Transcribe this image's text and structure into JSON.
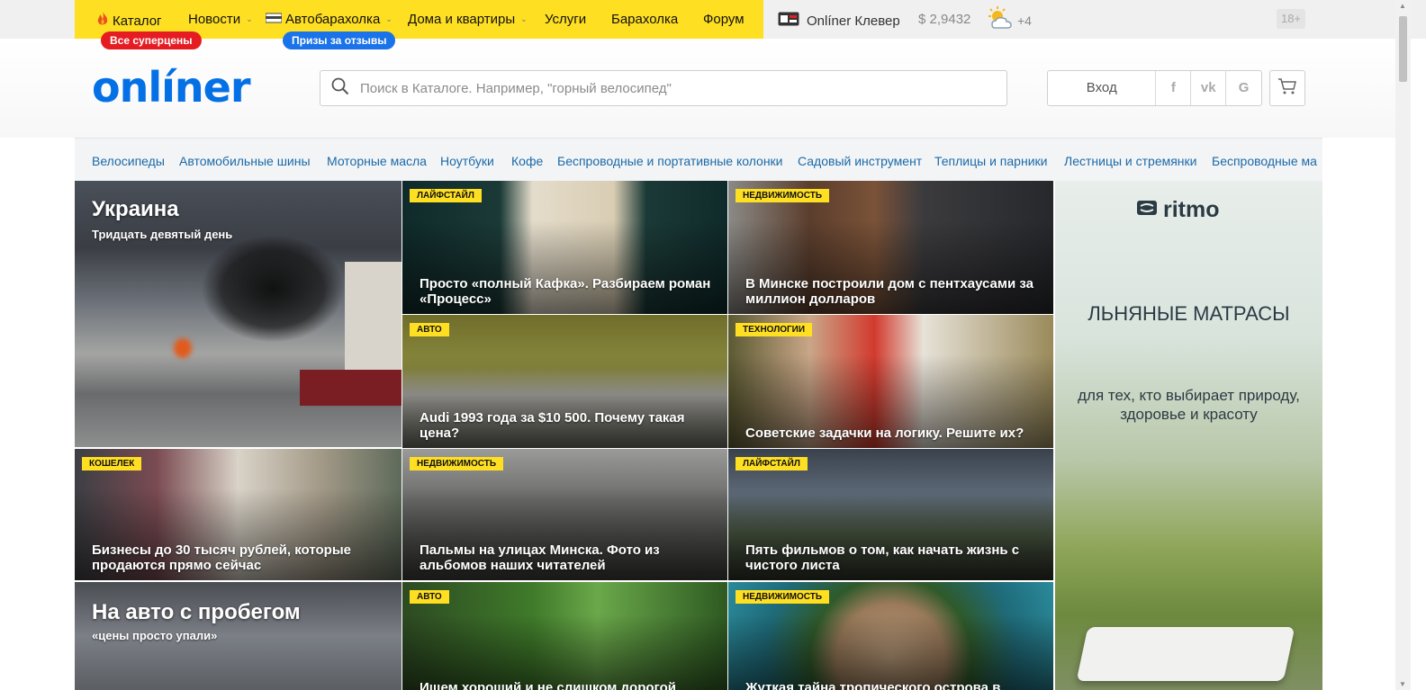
{
  "nav": {
    "items": [
      {
        "label": "Каталог",
        "has_chevron": false
      },
      {
        "label": "Новости",
        "has_chevron": true
      },
      {
        "label": "Автобарахолка",
        "has_chevron": true
      },
      {
        "label": "Дома и квартиры",
        "has_chevron": true
      },
      {
        "label": "Услуги",
        "has_chevron": false
      },
      {
        "label": "Барахолка",
        "has_chevron": false
      },
      {
        "label": "Форум",
        "has_chevron": false
      }
    ],
    "promo_catalog": "Все суперцены",
    "promo_auto": "Призы за отзывы",
    "klever": "Onlíner Клевер",
    "currency": "$ 2,9432",
    "weather": "+4",
    "age_badge": "18+"
  },
  "header": {
    "logo": "onlíner",
    "search_placeholder": "Поиск в Каталоге. Например, \"горный велосипед\"",
    "login": "Вход",
    "social": [
      "f",
      "vk",
      "G"
    ]
  },
  "categories": [
    "Велосипеды",
    "Автомобильные шины",
    "Моторные масла",
    "Ноутбуки",
    "Кофе",
    "Беспроводные и портативные колонки",
    "Садовый инструмент",
    "Теплицы и парники",
    "Лестницы и стремянки",
    "Беспроводные ма"
  ],
  "feature_ukraine": {
    "title": "Украина",
    "subtitle": "Тридцать девятый день"
  },
  "feature_auto": {
    "title": "На авто с пробегом",
    "subtitle": "«цены просто упали»"
  },
  "articles": [
    {
      "tag": "Лайфстайл",
      "title": "Просто «полный Кафка». Разбираем роман «Процесс»"
    },
    {
      "tag": "Недвижимость",
      "title": "В Минске построили дом с пентхаусами за миллион долларов"
    },
    {
      "tag": "Авто",
      "title": "Audi 1993 года за $10 500. Почему такая цена?"
    },
    {
      "tag": "Технологии",
      "title": "Советские задачки на логику. Решите их?"
    },
    {
      "tag": "Кошелек",
      "title": "Бизнесы до 30 тысяч рублей, которые продаются прямо сейчас"
    },
    {
      "tag": "Недвижимость",
      "title": "Пальмы на улицах Минска. Фото из альбомов наших читателей"
    },
    {
      "tag": "Лайфстайл",
      "title": "Пять фильмов о том, как начать жизнь с чистого листа"
    },
    {
      "tag": "Авто",
      "title": "Ищем хороший и не слишком дорогой"
    },
    {
      "tag": "Недвижимость",
      "title": "Жуткая тайна тропического острова в"
    }
  ],
  "ad": {
    "brand": "ritmo",
    "title": "ЛЬНЯНЫЕ МАТРАСЫ",
    "subtitle": "для тех, кто выбирает природу, здоровье и красоту"
  }
}
